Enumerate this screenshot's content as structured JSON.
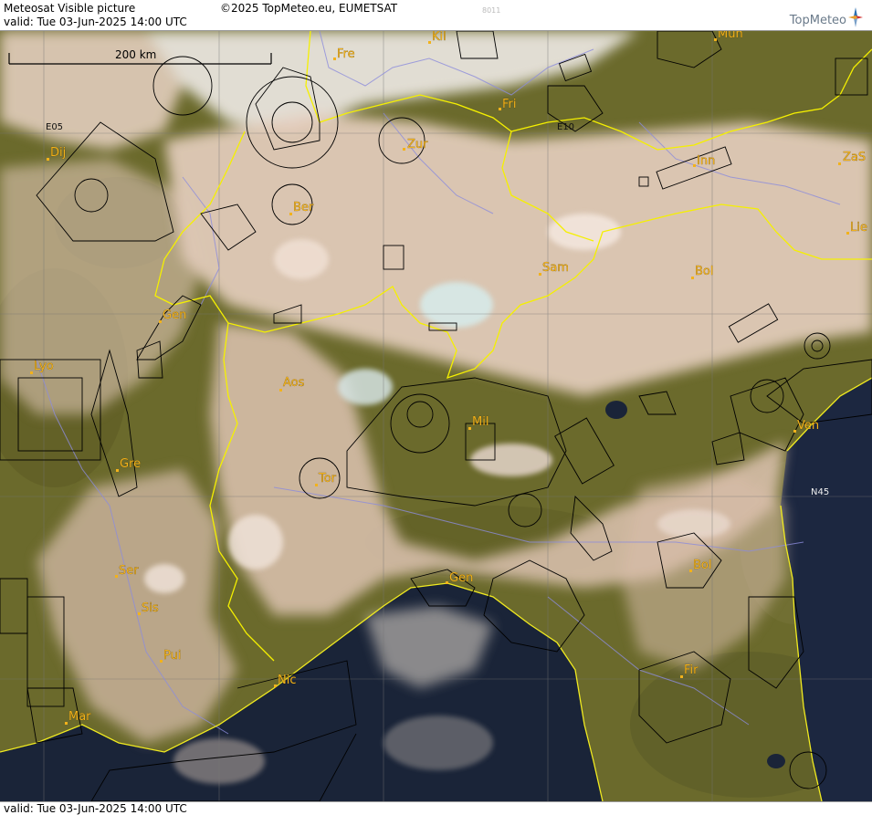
{
  "header": {
    "title": "Meteosat Visible picture",
    "copyright": "©2025 TopMeteo.eu, EUMETSAT",
    "code": "8011",
    "valid": "valid:  Tue  03-Jun-2025  14:00 UTC",
    "logo_text": "TopMeteo"
  },
  "footer": {
    "valid": "valid:  Tue  03-Jun-2025  14:00 UTC"
  },
  "scale_bar": {
    "label": "200 km"
  },
  "grid_labels": {
    "lon_west": "E05",
    "lon_east": "E10",
    "lat": "N45"
  },
  "cities": [
    {
      "id": "kil",
      "label": "Kil"
    },
    {
      "id": "fre",
      "label": "Fre"
    },
    {
      "id": "mun",
      "label": "Mun"
    },
    {
      "id": "fri",
      "label": "Fri"
    },
    {
      "id": "dij",
      "label": "Dij"
    },
    {
      "id": "zur",
      "label": "Zur"
    },
    {
      "id": "inn",
      "label": "Inn"
    },
    {
      "id": "zas",
      "label": "ZaS"
    },
    {
      "id": "ber",
      "label": "Ber"
    },
    {
      "id": "lie",
      "label": "Lie"
    },
    {
      "id": "sam",
      "label": "Sam"
    },
    {
      "id": "bol-n",
      "label": "Bol"
    },
    {
      "id": "gen-ch",
      "label": "Gen"
    },
    {
      "id": "lyo",
      "label": "Lyo"
    },
    {
      "id": "aos",
      "label": "Aos"
    },
    {
      "id": "mil",
      "label": "Mil"
    },
    {
      "id": "ven",
      "label": "Ven"
    },
    {
      "id": "gre",
      "label": "Gre"
    },
    {
      "id": "tor",
      "label": "Tor"
    },
    {
      "id": "ser",
      "label": "Ser"
    },
    {
      "id": "gen-it",
      "label": "Gen"
    },
    {
      "id": "bol-s",
      "label": "Bol"
    },
    {
      "id": "sis",
      "label": "Sis"
    },
    {
      "id": "pui",
      "label": "Pui"
    },
    {
      "id": "nic",
      "label": "Nic"
    },
    {
      "id": "fir",
      "label": "Fir"
    },
    {
      "id": "mar",
      "label": "Mar"
    }
  ],
  "colors": {
    "land": "#6b6a2c",
    "sea": "#1a2438",
    "cloud": "#e6d2c4",
    "border": "#f5f000",
    "coast": "#f0ea20",
    "river": "#8c8cdc",
    "airspace": "#000000",
    "city": "#f2b21b"
  }
}
